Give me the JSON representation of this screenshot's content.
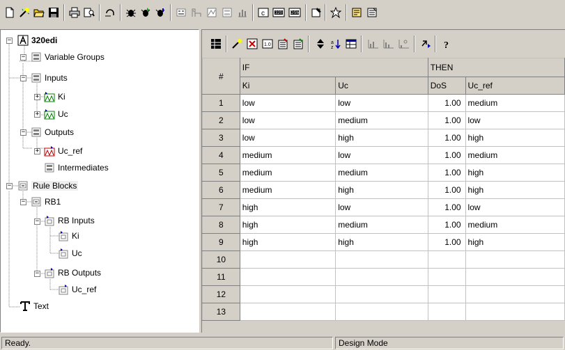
{
  "toolbar": {
    "buttons": [
      "new-icon",
      "new-wizard-icon",
      "open-icon",
      "save-icon",
      "print-icon",
      "print-preview-icon",
      "undo-icon",
      "debug-icon",
      "debug-run-icon",
      "debug-step-icon",
      "variable-editor-icon",
      "spreadsheet-editor-icon",
      "matrix-editor-icon",
      "form-icon",
      "analyzer-icon",
      "c-code-icon",
      "code-320-icon",
      "code-dsm-icon",
      "properties-icon",
      "options-icon",
      "dictionary-icon",
      "rule-editor-icon"
    ]
  },
  "tree": {
    "root": "320edi",
    "variable_groups": "Variable Groups",
    "inputs": "Inputs",
    "ki": "Ki",
    "uc": "Uc",
    "outputs": "Outputs",
    "uc_ref": "Uc_ref",
    "intermediates": "Intermediates",
    "rule_blocks": "Rule Blocks",
    "rb1": "RB1",
    "rb_inputs": "RB Inputs",
    "rb_ki": "Ki",
    "rb_uc": "Uc",
    "rb_outputs": "RB Outputs",
    "rb_uc_ref": "Uc_ref",
    "text": "Text"
  },
  "rule_toolbar": {
    "buttons": [
      "grid-mode-icon",
      "rule-wizard-icon",
      "delete-rule-icon",
      "dos-value-icon",
      "insert-rule-icon",
      "expand-rule-icon",
      "sort-icon",
      "alphabetic-sort-icon",
      "table-icon",
      "chart-1-icon",
      "chart-2-icon",
      "chart-3-icon",
      "link-icon",
      "help-icon"
    ]
  },
  "rule_table": {
    "num_header": "#",
    "if_header": "IF",
    "then_header": "THEN",
    "columns": [
      "Ki",
      "Uc",
      "DoS",
      "Uc_ref"
    ],
    "rows": [
      {
        "n": "1",
        "ki": "low",
        "uc": "low",
        "dos": "1.00",
        "out": "medium"
      },
      {
        "n": "2",
        "ki": "low",
        "uc": "medium",
        "dos": "1.00",
        "out": "low"
      },
      {
        "n": "3",
        "ki": "low",
        "uc": "high",
        "dos": "1.00",
        "out": "high"
      },
      {
        "n": "4",
        "ki": "medium",
        "uc": "low",
        "dos": "1.00",
        "out": "medium"
      },
      {
        "n": "5",
        "ki": "medium",
        "uc": "medium",
        "dos": "1.00",
        "out": "high"
      },
      {
        "n": "6",
        "ki": "medium",
        "uc": "high",
        "dos": "1.00",
        "out": "high"
      },
      {
        "n": "7",
        "ki": "high",
        "uc": "low",
        "dos": "1.00",
        "out": "low"
      },
      {
        "n": "8",
        "ki": "high",
        "uc": "medium",
        "dos": "1.00",
        "out": "medium"
      },
      {
        "n": "9",
        "ki": "high",
        "uc": "high",
        "dos": "1.00",
        "out": "high"
      },
      {
        "n": "10",
        "ki": "",
        "uc": "",
        "dos": "",
        "out": ""
      },
      {
        "n": "11",
        "ki": "",
        "uc": "",
        "dos": "",
        "out": ""
      },
      {
        "n": "12",
        "ki": "",
        "uc": "",
        "dos": "",
        "out": ""
      },
      {
        "n": "13",
        "ki": "",
        "uc": "",
        "dos": "",
        "out": ""
      }
    ]
  },
  "status": {
    "left": "Ready.",
    "right": "Design Mode"
  }
}
